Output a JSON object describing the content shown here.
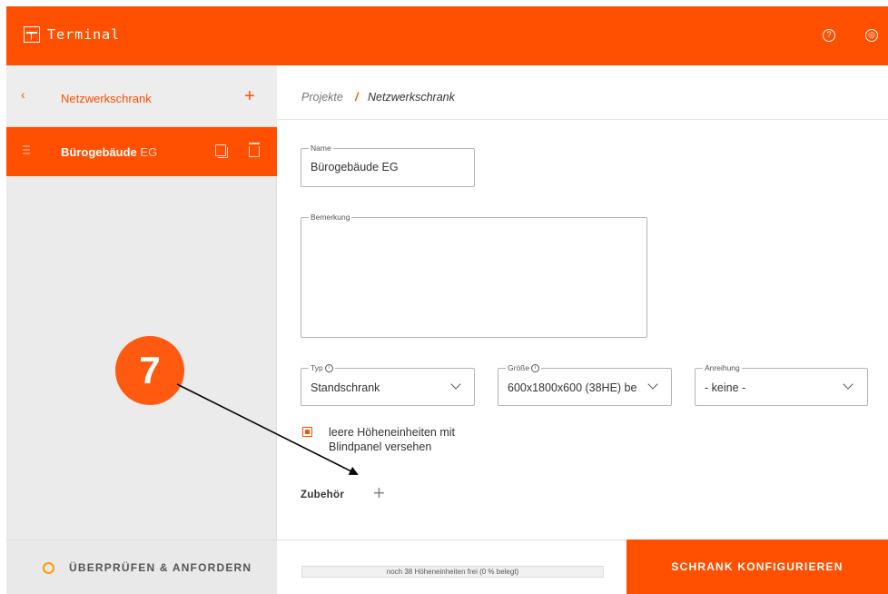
{
  "header": {
    "app_title": "Terminal",
    "help_icon": "help-icon",
    "settings_icon": "settings-icon"
  },
  "sidebar": {
    "title": "Netzwerkschrank",
    "back_icon": "chevron-left-icon",
    "add_icon": "plus-icon",
    "items": [
      {
        "name": "Bürogebäude",
        "suffix": "EG",
        "copy_icon": "copy-icon",
        "delete_icon": "trash-icon"
      }
    ]
  },
  "breadcrumb": {
    "items": [
      "Projekte",
      "Netzwerkschrank"
    ],
    "separator": "/"
  },
  "form": {
    "name": {
      "label": "Name",
      "value": "Bürogebäude EG"
    },
    "remark": {
      "label": "Bemerkung",
      "value": ""
    },
    "type": {
      "label": "Typ",
      "info": "i",
      "value": "Standschrank"
    },
    "size": {
      "label": "Größe",
      "info": "i",
      "value": "600x1800x600 (38HE) be"
    },
    "row": {
      "label": "Anreihung",
      "value": "- keine -"
    },
    "blind_panel": {
      "label": "leere Höheneinheiten mit Blindpanel versehen",
      "checked": true
    },
    "accessories": {
      "label": "Zubehör",
      "add_icon": "plus-icon"
    }
  },
  "footer": {
    "review_label": "ÜBERPRÜFEN & ANFORDERN",
    "progress_text": "noch 38 Höheneinheiten frei (0 % belegt)",
    "progress_percent": 0,
    "configure_label": "SCHRANK KONFIGURIEREN"
  },
  "annotation": {
    "number": "7"
  },
  "colors": {
    "accent": "#ff4f00",
    "review_ring": "#ff9a00",
    "sidebar_bg": "#ebebeb"
  }
}
